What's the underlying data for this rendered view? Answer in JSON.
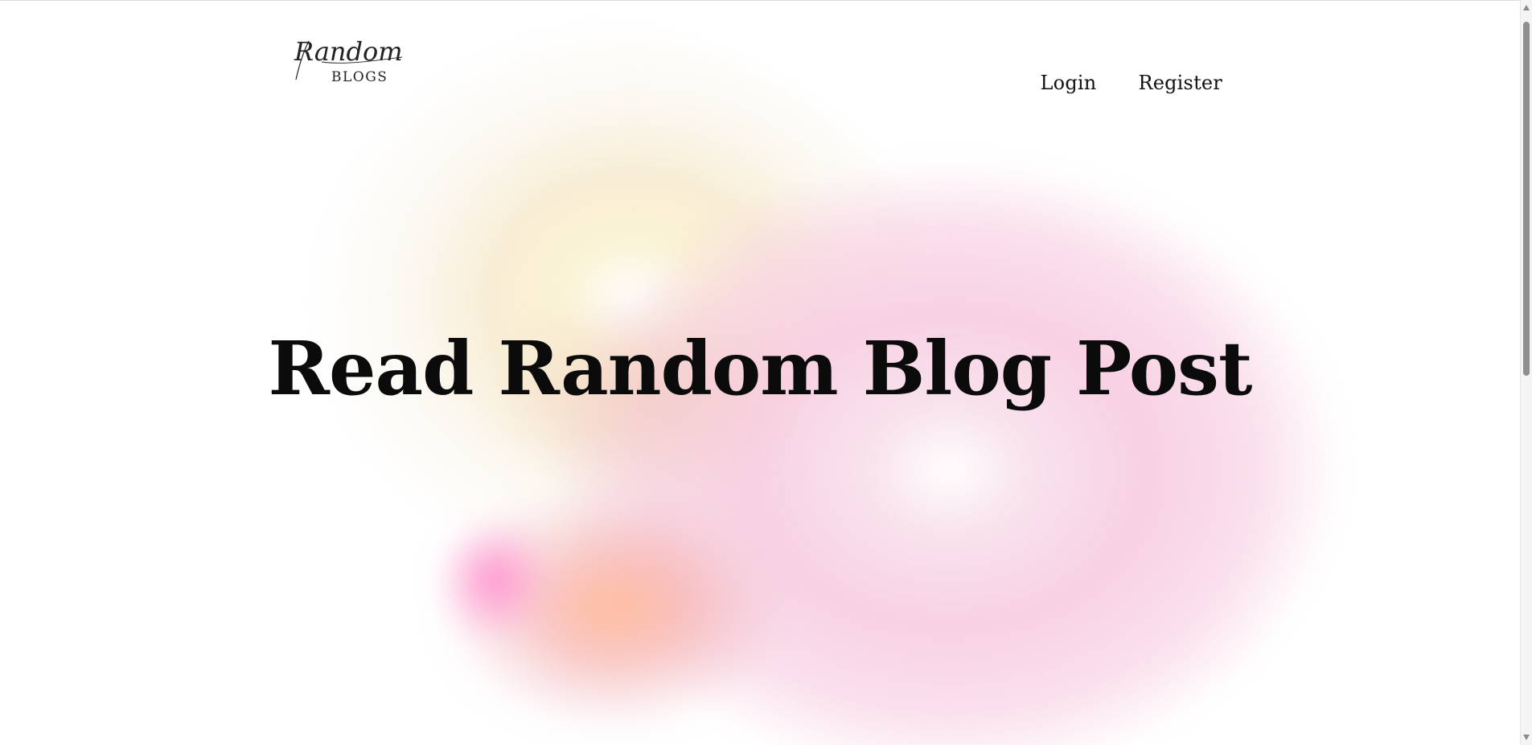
{
  "logo": {
    "script_text": "Random",
    "caps_text": "BLOGS",
    "icon": "random-blogs-logo"
  },
  "nav": {
    "login_label": "Login",
    "register_label": "Register"
  },
  "hero": {
    "title": "Read Random Blog Post"
  },
  "colors": {
    "text": "#0b0b0b",
    "blob_yellow": "#f6e8c8",
    "blob_pink": "#f7cde1",
    "blob_peach": "#ffb996",
    "blob_magenta": "#ff82c8",
    "background": "#ffffff"
  }
}
